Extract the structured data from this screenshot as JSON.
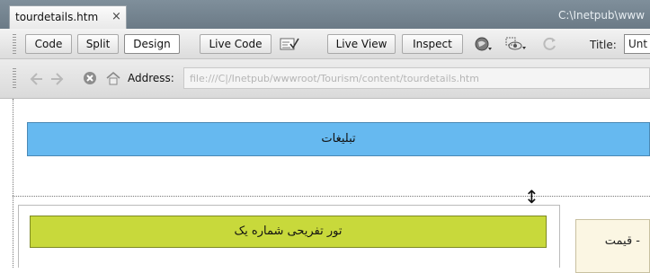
{
  "tab": {
    "filename": "tourdetails.htm",
    "close_glyph": "×"
  },
  "window_path": "C:\\Inetpub\\www",
  "toolbar": {
    "code": "Code",
    "split": "Split",
    "design": "Design",
    "live_code": "Live Code",
    "live_view": "Live View",
    "inspect": "Inspect",
    "title_label": "Title:",
    "title_value": "Unt"
  },
  "address": {
    "label": "Address:",
    "value": "file:///C|/Inetpub/wwwroot/Tourism/content/tourdetails.htm"
  },
  "design": {
    "banner_text": "تبلیغات",
    "tour_text": "تور تفریحی شماره یک",
    "price_text": "- قیمت",
    "resize_glyph": "↕"
  },
  "colors": {
    "banner": "#66b9f0",
    "tour_bar": "#c8d93b",
    "price_box": "#fbf6e3"
  }
}
